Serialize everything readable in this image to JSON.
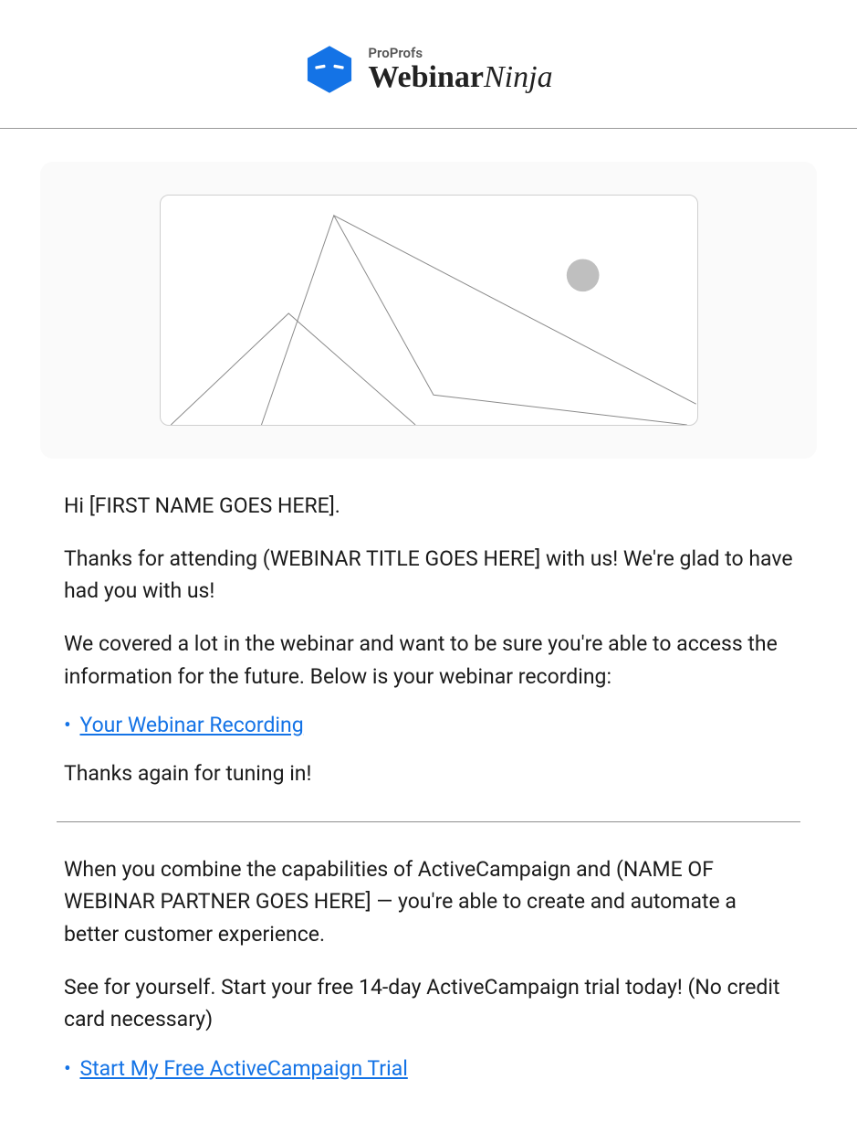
{
  "header": {
    "supertitle": "ProProfs",
    "title_bold": "Webinar",
    "title_italic": "Ninja"
  },
  "body": {
    "greeting": "Hi [FIRST NAME GOES HERE].",
    "thanks_attending": "Thanks for attending (WEBINAR TITLE GOES HERE] with us! We're glad to have had you with us!",
    "covered": "We covered a lot in the webinar and want to be sure you're able to access the information for the future. Below is your webinar recording:",
    "recording_link": "Your Webinar Recording",
    "thanks_again": "Thanks again for tuning in!",
    "combine": "When you combine the capabilities of ActiveCampaign and (NAME OF WEBINAR PARTNER GOES HERE] — you're able to create and automate a better customer experience.",
    "see_yourself": "See for yourself. Start your free 14-day ActiveCampaign trial today! (No credit card necessary)",
    "trial_link": "Start My Free ActiveCampaign Trial"
  }
}
